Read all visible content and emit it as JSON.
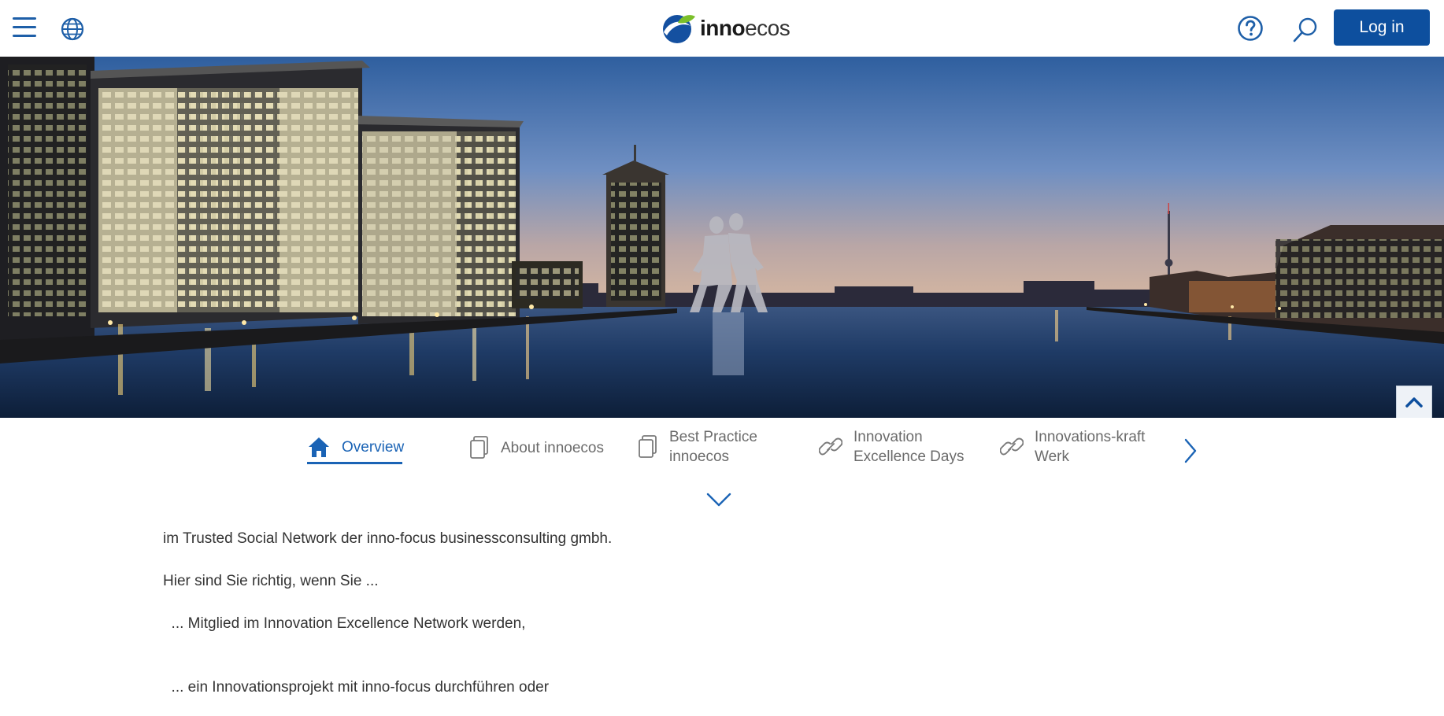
{
  "header": {
    "logo_bold": "inno",
    "logo_light": "ecos",
    "login_label": "Log in",
    "icons": [
      "menu-icon",
      "globe-icon",
      "help-icon",
      "search-icon"
    ]
  },
  "hero": {
    "colors": {
      "sky_top": "#2f5f9f",
      "sky_bottom": "#b9a6a6",
      "water": "#152a4c",
      "accent": "#f3d27a"
    }
  },
  "tabs": {
    "items": [
      {
        "line1": "Overview",
        "line2": "",
        "icon": "home-icon",
        "active": true
      },
      {
        "line1": "About innoecos",
        "line2": "",
        "icon": "document-icon",
        "active": false
      },
      {
        "line1": "Best Practice",
        "line2": "innoecos",
        "icon": "document-icon",
        "active": false
      },
      {
        "line1": "Innovation",
        "line2": "Excellence Days",
        "icon": "link-icon",
        "active": false
      },
      {
        "line1": "Innovations-kraft",
        "line2": "Werk",
        "icon": "link-icon",
        "active": false
      }
    ]
  },
  "content": {
    "line1": "im Trusted Social Network der inno-focus businessconsulting gmbh.",
    "line2": "Hier sind Sie richtig, wenn Sie ...",
    "line3": "  ... Mitglied im Innovation Excellence Network werden,",
    "line4": "  ... ein Innovationsprojekt mit inno-focus durchführen oder"
  },
  "accent_color": "#0d4f9e"
}
